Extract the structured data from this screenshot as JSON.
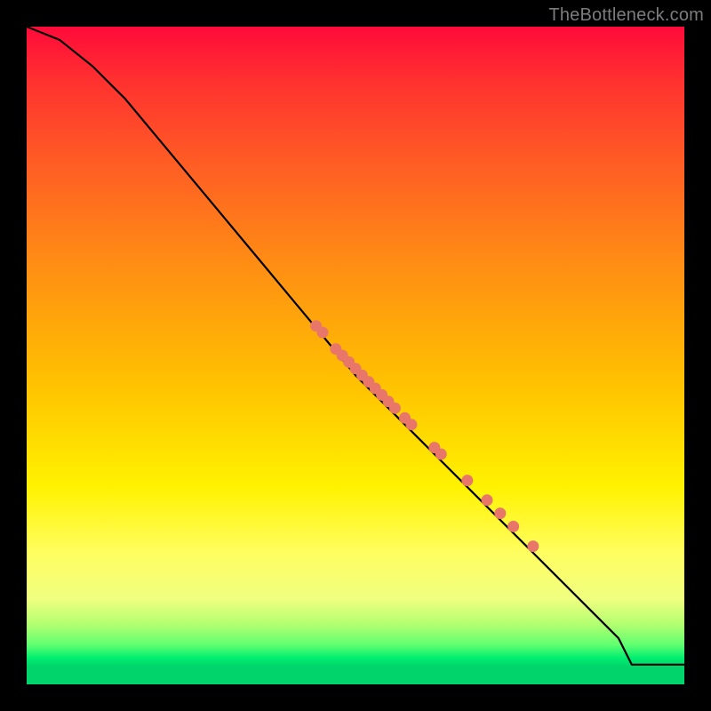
{
  "credit": "TheBottleneck.com",
  "colors": {
    "background": "#000000",
    "gradient_top": "#ff0a3a",
    "gradient_bottom": "#00d46a",
    "line": "#000000",
    "points": "#e8776a"
  },
  "chart_data": {
    "type": "line",
    "title": "",
    "xlabel": "",
    "ylabel": "",
    "xlim": [
      0,
      100
    ],
    "ylim": [
      0,
      100
    ],
    "series": [
      {
        "name": "curve",
        "x": [
          0,
          5,
          10,
          15,
          20,
          25,
          30,
          35,
          40,
          45,
          50,
          55,
          60,
          65,
          70,
          75,
          80,
          85,
          90,
          92,
          95,
          100
        ],
        "y": [
          100,
          98,
          94,
          89,
          83,
          77,
          71,
          65,
          59,
          53,
          47,
          42,
          37,
          32,
          27,
          22,
          17,
          12,
          7,
          3,
          3,
          3
        ]
      }
    ],
    "points": [
      {
        "x": 44,
        "y": 54.5
      },
      {
        "x": 45,
        "y": 53.5
      },
      {
        "x": 47,
        "y": 51
      },
      {
        "x": 48,
        "y": 50
      },
      {
        "x": 49,
        "y": 49
      },
      {
        "x": 50,
        "y": 48
      },
      {
        "x": 51,
        "y": 47
      },
      {
        "x": 52,
        "y": 46
      },
      {
        "x": 53,
        "y": 45
      },
      {
        "x": 54,
        "y": 44
      },
      {
        "x": 55,
        "y": 43
      },
      {
        "x": 56,
        "y": 42
      },
      {
        "x": 57.5,
        "y": 40.5
      },
      {
        "x": 58.5,
        "y": 39.5
      },
      {
        "x": 62,
        "y": 36
      },
      {
        "x": 63,
        "y": 35
      },
      {
        "x": 67,
        "y": 31
      },
      {
        "x": 70,
        "y": 28
      },
      {
        "x": 72,
        "y": 26
      },
      {
        "x": 74,
        "y": 24
      },
      {
        "x": 77,
        "y": 21
      }
    ]
  }
}
